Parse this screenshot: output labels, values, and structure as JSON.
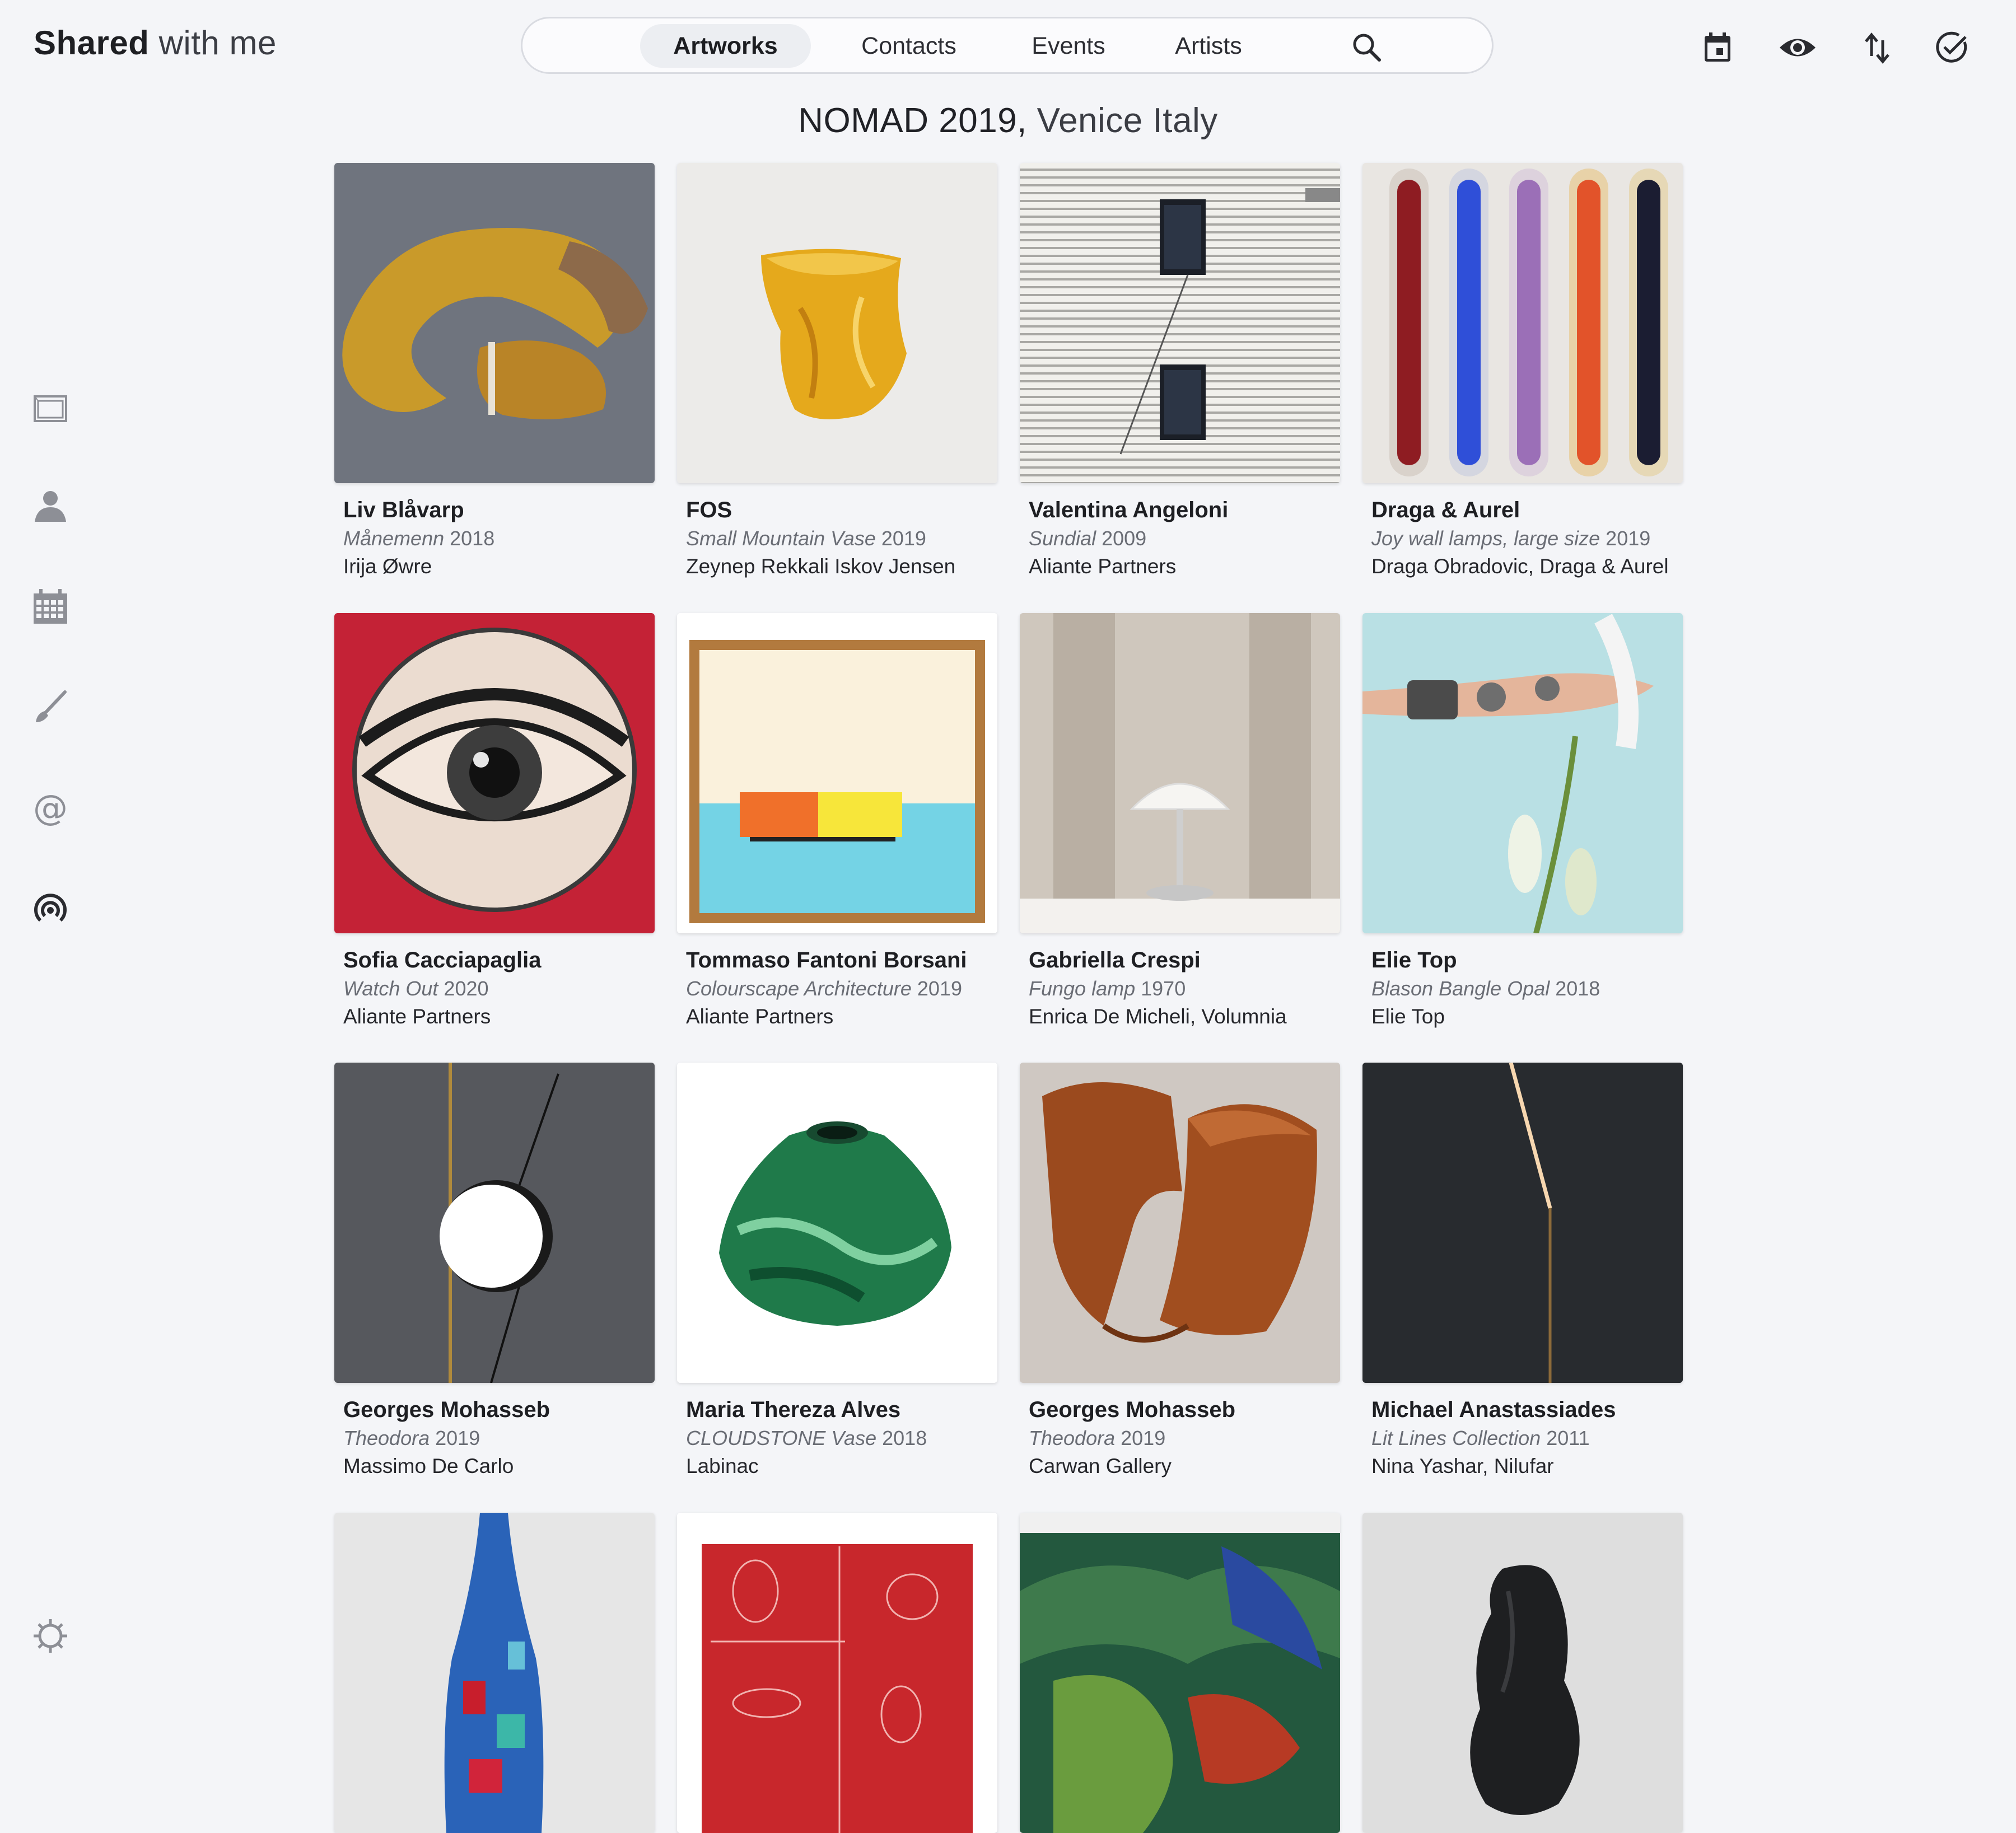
{
  "app": {
    "title_bold": "Shared",
    "title_rest": "with me"
  },
  "nav": {
    "tabs": [
      {
        "label": "Artworks",
        "active": true
      },
      {
        "label": "Contacts",
        "active": false
      },
      {
        "label": "Events",
        "active": false
      },
      {
        "label": "Artists",
        "active": false
      }
    ],
    "search_icon": "search-icon"
  },
  "toolbar": {
    "icons": [
      "calendar-icon",
      "eye-icon",
      "sort-icon",
      "check-circle-icon"
    ]
  },
  "page": {
    "event_name": "NOMAD 2019,",
    "location": "Venice Italy"
  },
  "sidebar": {
    "icons": [
      "artwork-frame-icon",
      "person-icon",
      "calendar-grid-icon",
      "brush-icon",
      "at-icon",
      "broadcast-icon",
      "settings-icon"
    ]
  },
  "colors": {
    "background": "#f4f5f8",
    "accent_border": "#d9dbe1",
    "icon_gray": "#8d8f96"
  },
  "artworks": [
    {
      "artist": "Liv Blåvarp",
      "title": "Månemenn",
      "year": "2018",
      "owner": "Irija Øwre"
    },
    {
      "artist": "FOS",
      "title": "Small Mountain Vase",
      "year": "2019",
      "owner": "Zeynep Rekkali Iskov Jensen"
    },
    {
      "artist": "Valentina Angeloni",
      "title": "Sundial",
      "year": "2009",
      "owner": "Aliante Partners"
    },
    {
      "artist": "Draga & Aurel",
      "title": "Joy wall lamps, large size",
      "year": "2019",
      "owner": "Draga Obradovic, Draga & Aurel"
    },
    {
      "artist": "Sofia Cacciapaglia",
      "title": "Watch Out",
      "year": "2020",
      "owner": "Aliante Partners"
    },
    {
      "artist": "Tommaso Fantoni Borsani",
      "title": "Colourscape Architecture",
      "year": "2019",
      "owner": "Aliante Partners"
    },
    {
      "artist": "Gabriella Crespi",
      "title": "Fungo lamp",
      "year": "1970",
      "owner": "Enrica De Micheli, Volumnia"
    },
    {
      "artist": "Elie Top",
      "title": "Blason Bangle Opal",
      "year": "2018",
      "owner": "Elie Top"
    },
    {
      "artist": "Georges Mohasseb",
      "title": "Theodora",
      "year": "2019",
      "owner": "Massimo De Carlo"
    },
    {
      "artist": "Maria Thereza Alves",
      "title": "CLOUDSTONE Vase",
      "year": "2018",
      "owner": "Labinac"
    },
    {
      "artist": "Georges Mohasseb",
      "title": "Theodora",
      "year": "2019",
      "owner": "Carwan Gallery"
    },
    {
      "artist": "Michael Anastassiades",
      "title": "Lit Lines Collection",
      "year": "2011",
      "owner": "Nina Yashar, Nilufar"
    }
  ]
}
